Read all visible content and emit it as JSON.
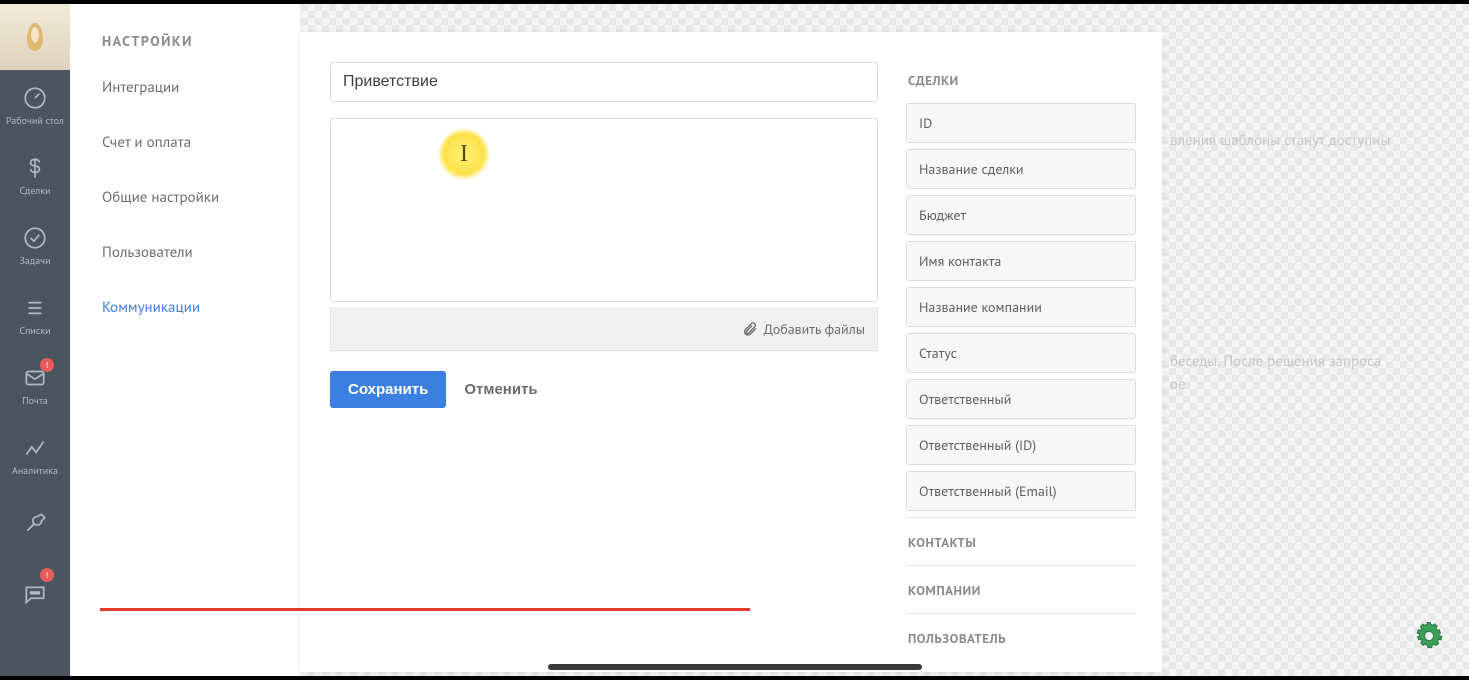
{
  "rail": {
    "items": [
      {
        "label": "Рабочий стол"
      },
      {
        "label": "Сделки"
      },
      {
        "label": "Задачи"
      },
      {
        "label": "Списки"
      },
      {
        "label": "Почта",
        "badge": "!"
      },
      {
        "label": "Аналитика"
      },
      {
        "label": ""
      },
      {
        "label": "",
        "badge": "!"
      }
    ]
  },
  "sidebar": {
    "title": "НАСТРОЙКИ",
    "items": [
      {
        "label": "Интеграции"
      },
      {
        "label": "Счет и оплата"
      },
      {
        "label": "Общие настройки"
      },
      {
        "label": "Пользователи"
      },
      {
        "label": "Коммуникации"
      }
    ],
    "active_index": 4
  },
  "editor": {
    "title_value": "Приветствие",
    "body_value": "",
    "attach_label": "Добавить файлы",
    "save_label": "Сохранить",
    "cancel_label": "Отменить"
  },
  "tags": {
    "section_deals": "СДЕЛКИ",
    "section_contacts": "КОНТАКТЫ",
    "section_companies": "КОМПАНИИ",
    "section_user": "ПОЛЬЗОВАТЕЛЬ",
    "deals": [
      "ID",
      "Название сделки",
      "Бюджет",
      "Имя контакта",
      "Название компании",
      "Статус",
      "Ответственный",
      "Ответственный (ID)",
      "Ответственный (Email)"
    ]
  },
  "ghost": {
    "line1": "вления шаблоны станут доступны",
    "line2": "беседы. После решения запроса",
    "line3": "ое"
  },
  "cursor_glyph": "I"
}
